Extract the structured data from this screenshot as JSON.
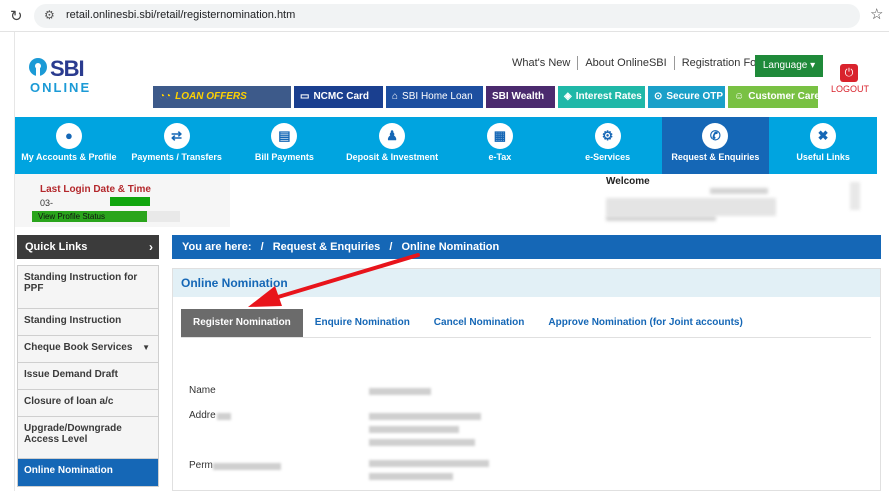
{
  "browser": {
    "url": "retail.onlinesbi.sbi/retail/registernomination.htm"
  },
  "logo": {
    "brand": "SBI",
    "sub": "ONLINE"
  },
  "top_links": [
    "What's New",
    "About OnlineSBI",
    "Registration Forms"
  ],
  "language_label": "Language",
  "logout_label": "LOGOUT",
  "promos": [
    {
      "label": "LOAN OFFERS"
    },
    {
      "label": "NCMC Card"
    },
    {
      "label": "SBI Home Loan"
    },
    {
      "label": "SBI Wealth"
    },
    {
      "label": "Interest Rates"
    },
    {
      "label": "Secure OTP"
    },
    {
      "label": "Customer Care"
    }
  ],
  "main_nav": [
    {
      "label": "My Accounts & Profile",
      "icon": "user-icon"
    },
    {
      "label": "Payments / Transfers",
      "icon": "transfer-icon"
    },
    {
      "label": "Bill Payments",
      "icon": "bill-icon"
    },
    {
      "label": "Deposit & Investment",
      "icon": "deposit-icon"
    },
    {
      "label": "e-Tax",
      "icon": "tax-icon"
    },
    {
      "label": "e-Services",
      "icon": "services-icon"
    },
    {
      "label": "Request & Enquiries",
      "icon": "phone-icon"
    },
    {
      "label": "Useful Links",
      "icon": "links-icon"
    }
  ],
  "login": {
    "title": "Last Login Date & Time",
    "date_prefix": "03-",
    "profile_status": "View Profile Status",
    "profile_progress": 0.78
  },
  "welcome": "Welcome",
  "quick_links": {
    "title": "Quick Links",
    "items": [
      "Standing Instruction for PPF",
      "Standing Instruction",
      "Cheque Book Services",
      "Issue Demand Draft",
      "Closure of loan a/c",
      "Upgrade/Downgrade Access Level",
      "Online Nomination"
    ]
  },
  "breadcrumb": {
    "prefix": "You are here:",
    "sep": "/",
    "section": "Request & Enquiries",
    "page": "Online Nomination"
  },
  "panel": {
    "title": "Online Nomination",
    "tabs": [
      "Register Nomination",
      "Enquire Nomination",
      "Cancel Nomination",
      "Approve Nomination (for Joint accounts)"
    ],
    "fields": [
      "Name",
      "Addre",
      "Perm"
    ]
  },
  "colors": {
    "nav_bg": "#00a4e0",
    "nav_active": "#1567b6",
    "arrow": "#e8141b"
  }
}
